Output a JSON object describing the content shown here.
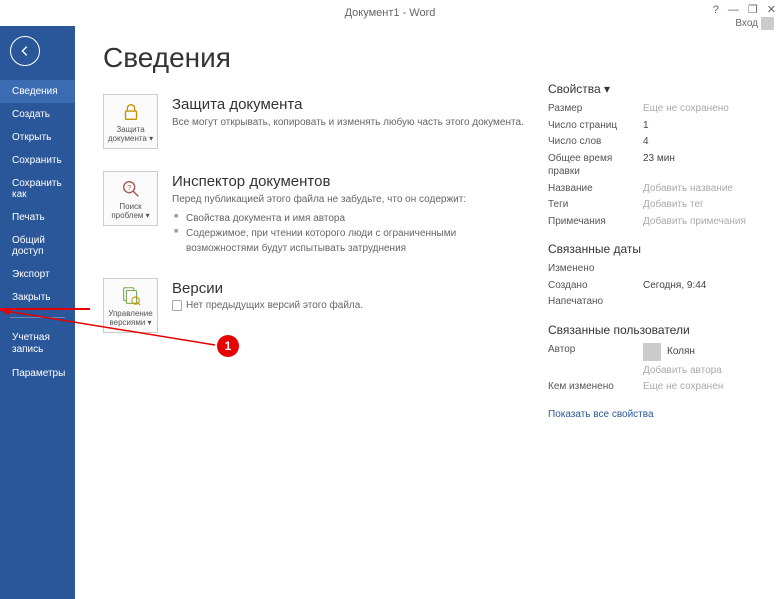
{
  "titlebar": {
    "title": "Документ1 - Word",
    "login": "Вход"
  },
  "sidebar": {
    "items": [
      "Сведения",
      "Создать",
      "Открыть",
      "Сохранить",
      "Сохранить как",
      "Печать",
      "Общий доступ",
      "Экспорт",
      "Закрыть"
    ],
    "account": "Учетная запись",
    "params": "Параметры"
  },
  "page_title": "Сведения",
  "sections": {
    "protect": {
      "btn": "Защита документа ▾",
      "title": "Защита документа",
      "desc": "Все могут открывать, копировать и изменять любую часть этого документа."
    },
    "inspect": {
      "btn": "Поиск проблем ▾",
      "title": "Инспектор документов",
      "desc": "Перед публикацией этого файла не забудьте, что он содержит:",
      "items": [
        "Свойства документа и имя автора",
        "Содержимое, при чтении которого люди с ограниченными возможностями будут испытывать затруднения"
      ]
    },
    "versions": {
      "btn": "Управление версиями ▾",
      "title": "Версии",
      "none": "Нет предыдущих версий этого файла."
    }
  },
  "properties": {
    "head": "Свойства ▾",
    "rows": [
      {
        "k": "Размер",
        "v": "Еще не сохранено",
        "gray": true
      },
      {
        "k": "Число страниц",
        "v": "1"
      },
      {
        "k": "Число слов",
        "v": "4"
      },
      {
        "k": "Общее время правки",
        "v": "23 мин"
      },
      {
        "k": "Название",
        "v": "Добавить название",
        "gray": true
      },
      {
        "k": "Теги",
        "v": "Добавить тег",
        "gray": true
      },
      {
        "k": "Примечания",
        "v": "Добавить примечания",
        "gray": true
      }
    ],
    "dates_head": "Связанные даты",
    "dates": [
      {
        "k": "Изменено",
        "v": ""
      },
      {
        "k": "Создано",
        "v": "Сегодня, 9:44"
      },
      {
        "k": "Напечатано",
        "v": ""
      }
    ],
    "users_head": "Связанные пользователи",
    "author_label": "Автор",
    "author_name": "Колян",
    "add_author": "Добавить автора",
    "modified_by_k": "Кем изменено",
    "modified_by_v": "Еще не сохранен",
    "show_all": "Показать все свойства"
  },
  "annotation": {
    "badge": "1"
  }
}
